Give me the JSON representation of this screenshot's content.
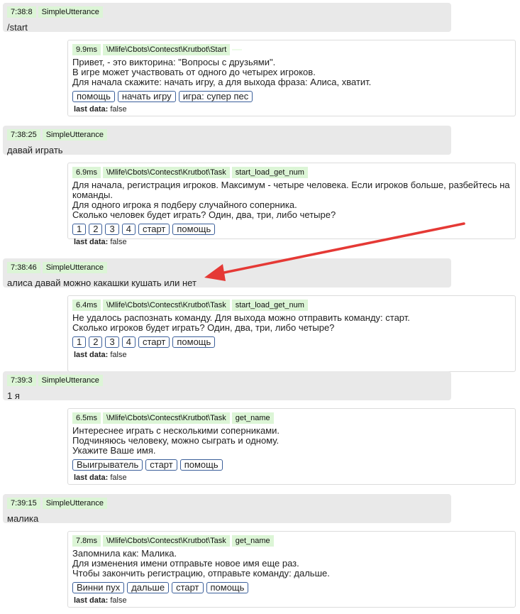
{
  "arrow_color": "#e53935",
  "entries": [
    {
      "user": {
        "time": "7:38:8",
        "type": "SimpleUtterance",
        "text": "/start"
      },
      "bot": {
        "ms": "9.9ms",
        "path": "\\Mlife\\Cbots\\Contecst\\Krutbot\\Start",
        "state": "",
        "lines": [
          "Привет, - это викторина: \"Вопросы с друзьями\".",
          "В игре может участвовать от одного до четырех игроков.",
          "Для начала скажите: начать игру, а для выхода фраза: Алиса, хватит."
        ],
        "buttons": [
          "помощь",
          "начать игру",
          "игра: супер пес"
        ],
        "last_label": "last data:",
        "last_value": "false"
      }
    },
    {
      "user": {
        "time": "7:38:25",
        "type": "SimpleUtterance",
        "text": "давай играть"
      },
      "bot": {
        "ms": "6.9ms",
        "path": "\\Mlife\\Cbots\\Contecst\\Krutbot\\Task",
        "state": "start_load_get_num",
        "lines": [
          "Для начала, регистрация игроков. Максимум - четыре человека. Если игроков больше, разбейтесь на",
          "команды.",
          "Для одного игрока я подберу случайного соперника.",
          "Сколько человек будет играть? Один, два, три, либо четыре?"
        ],
        "buttons": [
          "1",
          "2",
          "3",
          "4",
          "старт",
          "помощь"
        ],
        "last_label": "last data:",
        "last_value": "false"
      }
    },
    {
      "user": {
        "time": "7:38:46",
        "type": "SimpleUtterance",
        "text": "алиса давай можно какашки кушать или нет"
      },
      "bot": {
        "ms": "6.4ms",
        "path": "\\Mlife\\Cbots\\Contecst\\Krutbot\\Task",
        "state": "start_load_get_num",
        "lines": [
          "Не удалось распознать команду. Для выхода можно отправить команду: старт.",
          "Сколько игроков будет играть? Один, два, три, либо четыре?"
        ],
        "buttons": [
          "1",
          "2",
          "3",
          "4",
          "старт",
          "помощь"
        ],
        "last_label": "last data:",
        "last_value": "false"
      }
    },
    {
      "user": {
        "time": "7:39:3",
        "type": "SimpleUtterance",
        "text": "1 я"
      },
      "bot": {
        "ms": "6.5ms",
        "path": "\\Mlife\\Cbots\\Contecst\\Krutbot\\Task",
        "state": "get_name",
        "lines": [
          "Интереснее играть с несколькими соперниками.",
          "Подчиняюсь человеку, можно сыграть и одному.",
          "Укажите Ваше имя."
        ],
        "buttons": [
          "Выигрыватель",
          "старт",
          "помощь"
        ],
        "last_label": "last data:",
        "last_value": "false"
      }
    },
    {
      "user": {
        "time": "7:39:15",
        "type": "SimpleUtterance",
        "text": "малика"
      },
      "bot": {
        "ms": "7.8ms",
        "path": "\\Mlife\\Cbots\\Contecst\\Krutbot\\Task",
        "state": "get_name",
        "lines": [
          "Запомнила как: Малика.",
          "Для изменения имени отправьте новое имя еще раз.",
          "Чтобы закончить регистрацию, отправьте команду: дальше."
        ],
        "buttons": [
          "Винни пух",
          "дальше",
          "старт",
          "помощь"
        ],
        "last_label": "last data:",
        "last_value": "false"
      }
    }
  ]
}
